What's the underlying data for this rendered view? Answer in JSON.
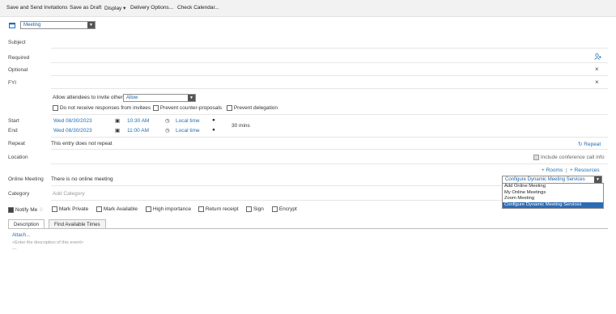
{
  "toolbar": {
    "send": "Save and Send Invitations",
    "draft": "Save as Draft",
    "display": "Display",
    "delivery": "Delivery Options...",
    "calendar": "Check Calendar..."
  },
  "type_select": {
    "value": "Meeting"
  },
  "fields": {
    "subject": "Subject",
    "required": "Required",
    "optional": "Optional",
    "fyi": "FYI",
    "start": "Start",
    "end": "End",
    "repeat": "Repeat",
    "location": "Location",
    "online": "Online Meeting",
    "category": "Category"
  },
  "invite": {
    "label": "Allow attendees to invite others",
    "value": "Allow"
  },
  "response_options": {
    "no_responses": "Do not receive responses from invitees",
    "no_counter": "Prevent counter-proposals",
    "no_delegation": "Prevent delegation"
  },
  "start": {
    "date": "Wed 08/30/2023",
    "time": "10:30 AM",
    "tz": "Local time"
  },
  "end": {
    "date": "Wed 08/30/2023",
    "time": "11:00 AM",
    "tz": "Local time"
  },
  "duration": "30 mins",
  "repeat": {
    "text": "This entry does not repeat",
    "link": "Repeat"
  },
  "location": {
    "conference": "Include conference call info"
  },
  "resources": {
    "rooms": "Rooms",
    "resources": "Resources"
  },
  "online_meeting": {
    "text": "There is no online meeting",
    "selected": "Configure Dynamic Meeting Services",
    "options": [
      "Add Online Meeting",
      "My Online Meetings",
      "Zoom Meeting",
      "Configure Dynamic Meeting Services"
    ]
  },
  "category": {
    "placeholder": "Add Category"
  },
  "flags": {
    "notify": "Notify Me",
    "private": "Mark Private",
    "available": "Mark Available",
    "importance": "High importance",
    "receipt": "Return receipt",
    "sign": "Sign",
    "encrypt": "Encrypt"
  },
  "tabs": {
    "description": "Description",
    "times": "Find Available Times"
  },
  "description": {
    "attach": "Attach...",
    "placeholder": "<Enter the description of this event>",
    "dash": "---"
  },
  "colors": {
    "accent": "#1f6fb8",
    "selected_bg": "#2d6bb5"
  }
}
